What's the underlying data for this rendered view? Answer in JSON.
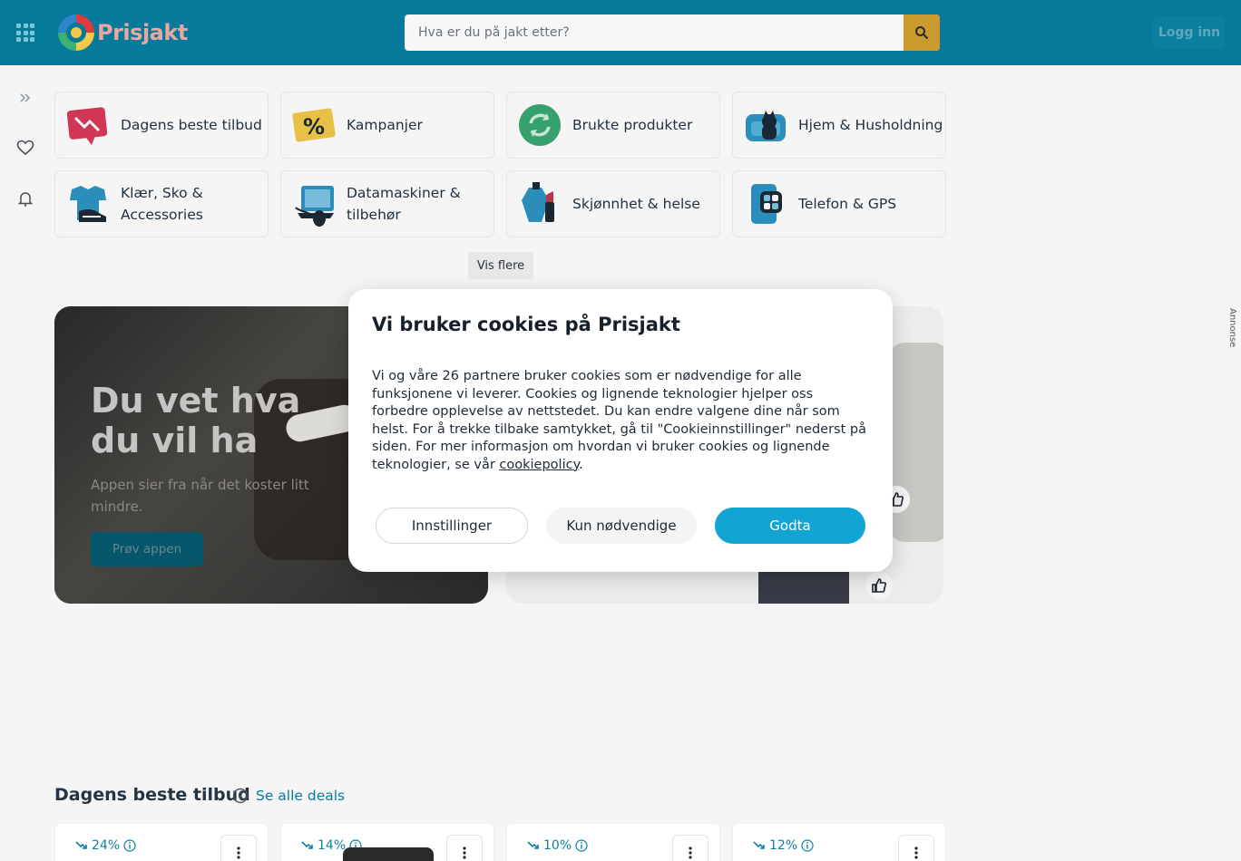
{
  "header": {
    "logo_text": "Prisjakt",
    "search_placeholder": "Hva er du på jakt etter?",
    "login_label": "Logg inn"
  },
  "categories": [
    {
      "label": "Dagens beste tilbud",
      "icon": "trending-down-tag-icon"
    },
    {
      "label": "Kampanjer",
      "icon": "percent-tag-icon"
    },
    {
      "label": "Brukte produkter",
      "icon": "recycle-icon"
    },
    {
      "label": "Hjem & Husholdning",
      "icon": "armchair-cat-icon"
    },
    {
      "label": "Klær, Sko & Accessories",
      "icon": "tshirt-shoe-icon"
    },
    {
      "label": "Datamaskiner & tilbehør",
      "icon": "laptop-mouse-icon"
    },
    {
      "label": "Skjønnhet & helse",
      "icon": "perfume-lipstick-icon"
    },
    {
      "label": "Telefon & GPS",
      "icon": "smartphone-icon"
    }
  ],
  "show_more_label": "Vis flere",
  "promo": {
    "title": "Du vet hva du vil ha",
    "subtitle": "Appen sier fra når det koster litt mindre.",
    "button_label": "Prøv appen"
  },
  "ad_label": "Annonse",
  "cookie_modal": {
    "title": "Vi bruker cookies på Prisjakt",
    "body": "Vi og våre 26 partnere bruker cookies som er nødvendige for alle funksjonene vi leverer. Cookies og lignende teknologier hjelper oss forbedre opplevelse av nettstedet. Du kan endre valgene dine når som helst. For å trekke tilbake samtykket, gå til \"Cookieinnstillinger\" nederst på siden. For mer informasjon om hvordan vi bruker cookies og lignende teknologier, se vår ",
    "link_text": "cookiepolicy",
    "body_end": ".",
    "settings_label": "Innstillinger",
    "necessary_label": "Kun nødvendige",
    "accept_label": "Godta"
  },
  "deals": {
    "title": "Dagens beste tilbud",
    "link_label": "Se alle deals",
    "items": [
      {
        "discount": "24%"
      },
      {
        "discount": "14%"
      },
      {
        "discount": "10%"
      },
      {
        "discount": "12%"
      }
    ]
  },
  "colors": {
    "header_bg": "#067a9b",
    "accept_button": "#12a5d4",
    "link": "#0a7aa5"
  }
}
